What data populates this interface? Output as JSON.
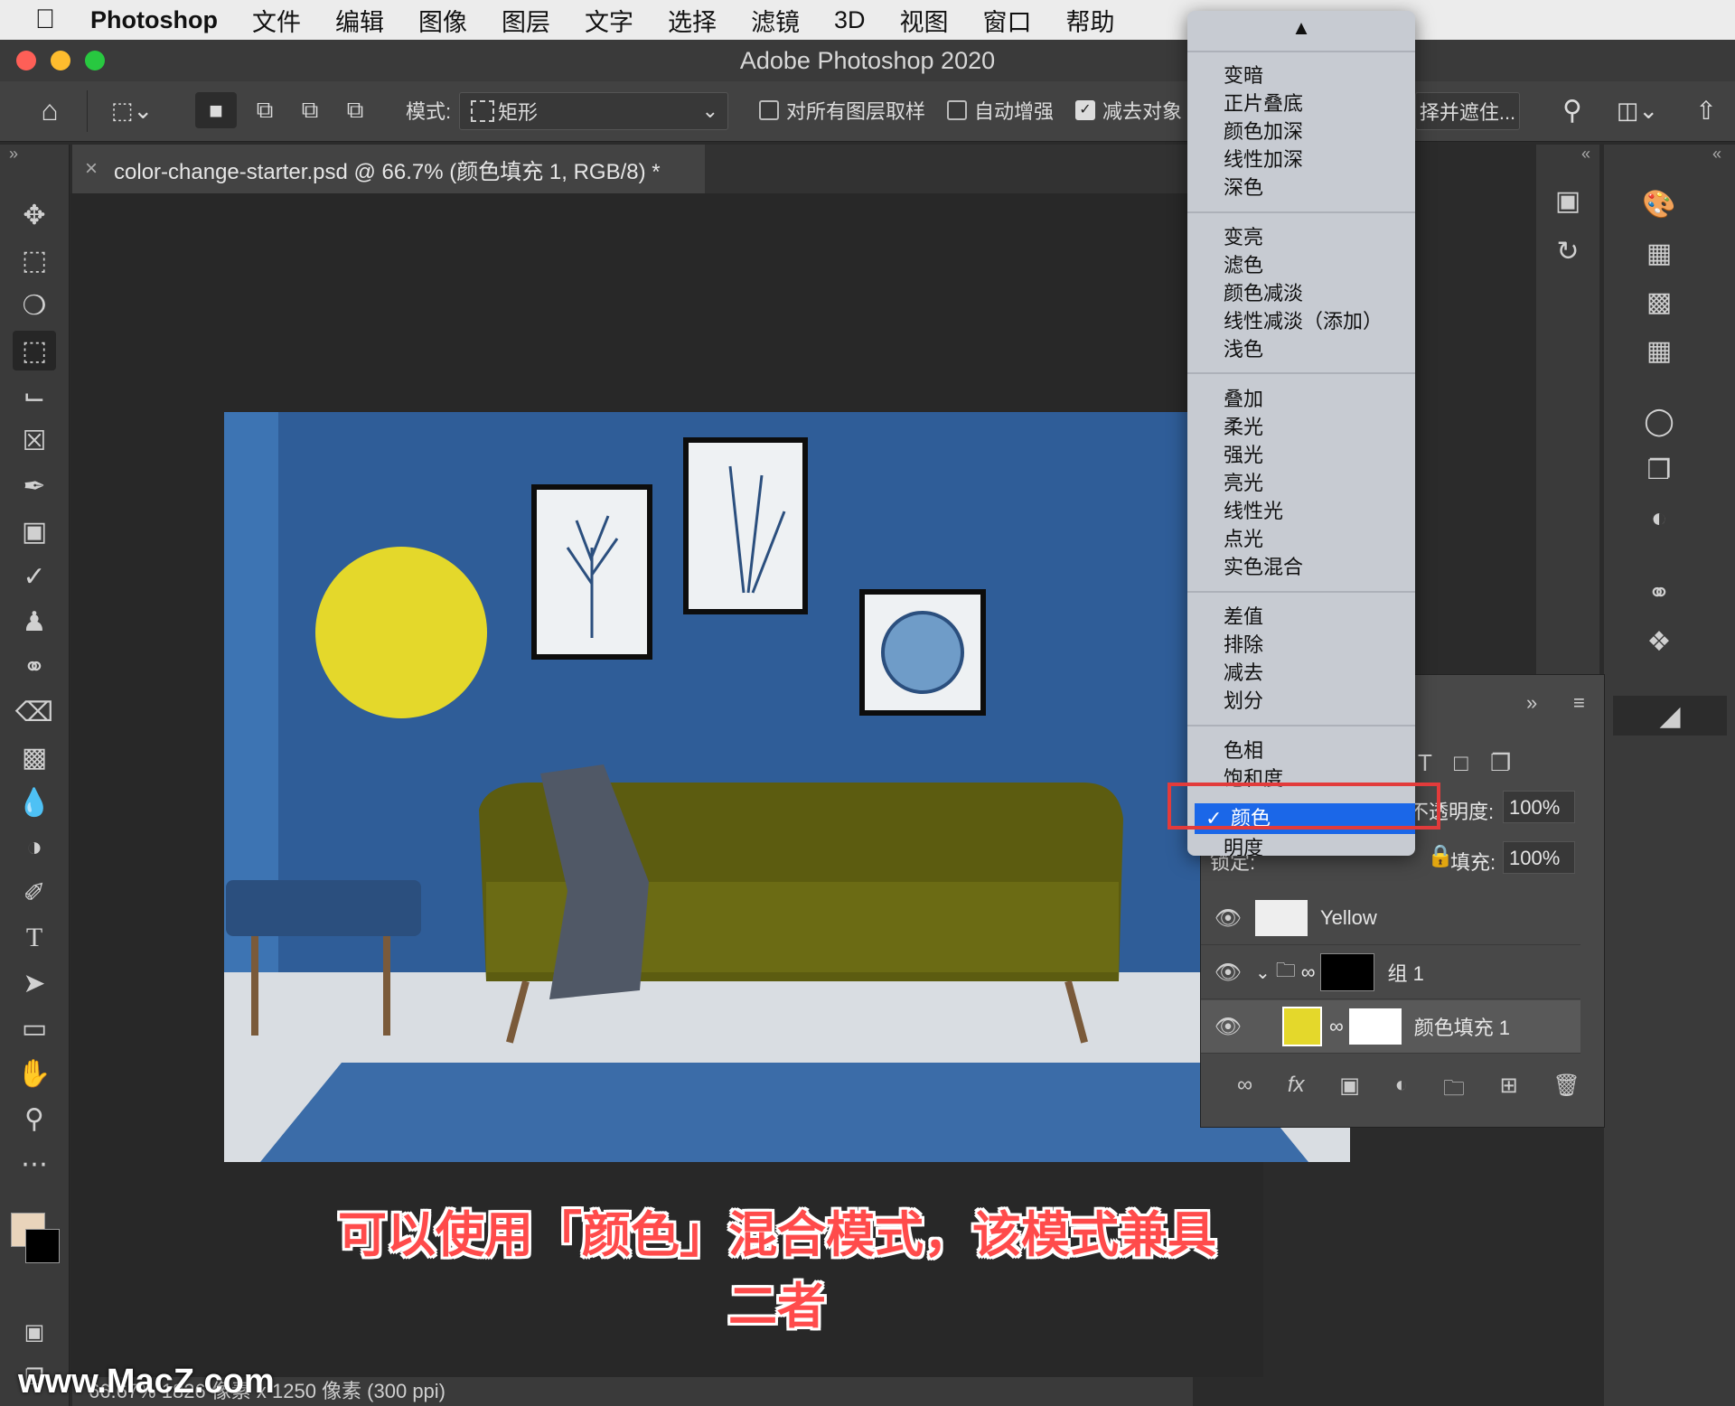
{
  "menubar": {
    "app": "Photoshop",
    "items": [
      "文件",
      "编辑",
      "图像",
      "图层",
      "文字",
      "选择",
      "滤镜",
      "3D",
      "视图",
      "窗口",
      "帮助"
    ]
  },
  "window": {
    "title": "Adobe Photoshop 2020"
  },
  "options": {
    "mode_label": "模式:",
    "mode_value": "矩形",
    "sample_all": "对所有图层取样",
    "auto_enhance": "自动增强",
    "subtract": "减去对象",
    "select_mask": "择并遮住..."
  },
  "document_tab": {
    "close": "×",
    "title": "color-change-starter.psd @ 66.7% (颜色填充 1, RGB/8) *"
  },
  "blend_menu": {
    "arrow": "▲",
    "groups": [
      [
        "变暗",
        "正片叠底",
        "颜色加深",
        "线性加深",
        "深色"
      ],
      [
        "变亮",
        "滤色",
        "颜色减淡",
        "线性减淡（添加）",
        "浅色"
      ],
      [
        "叠加",
        "柔光",
        "强光",
        "亮光",
        "线性光",
        "点光",
        "实色混合"
      ],
      [
        "差值",
        "排除",
        "减去",
        "划分"
      ],
      [
        "色相",
        "饱和度"
      ]
    ],
    "selected": "颜色",
    "check": "✓",
    "after": "明度"
  },
  "layers_panel": {
    "opacity_label": "不透明度:",
    "opacity_value": "100%",
    "lock_label": "锁定:",
    "fill_label": "填充:",
    "fill_value": "100%",
    "layers": [
      {
        "name": "Yellow"
      },
      {
        "name": "组 1"
      },
      {
        "name": "颜色填充 1"
      }
    ]
  },
  "caption": "可以使用「颜色」混合模式，该模式兼具二者",
  "status": {
    "text": "66.67%   1826 像素 x 1250 像素 (300 ppi)"
  },
  "watermark": "www.MacZ.com",
  "colors": {
    "wall": "#2f5d98",
    "sun": "#e4d82b",
    "sofa": "#5c5c10",
    "highlight": "#1b67e8",
    "caption": "#ff4b4b"
  }
}
